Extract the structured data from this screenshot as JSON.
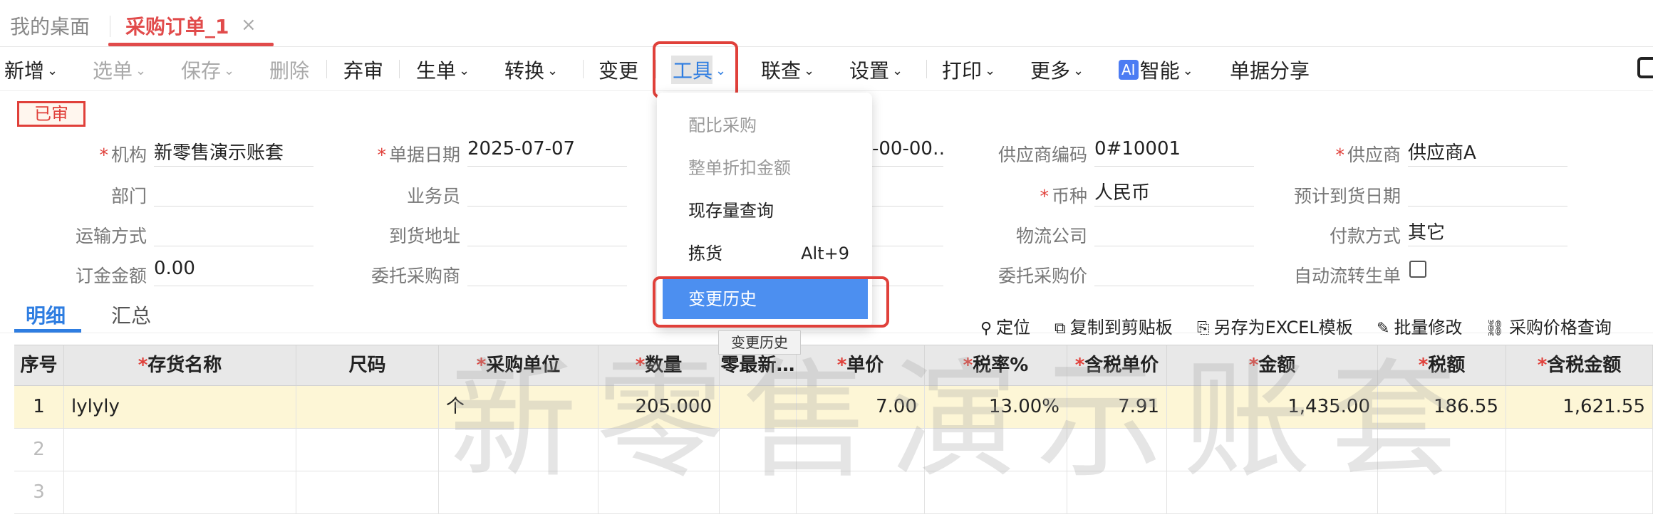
{
  "tabs": [
    {
      "label": "我的桌面"
    },
    {
      "label": "采购订单_1",
      "close": "×"
    }
  ],
  "toolbar": {
    "items": [
      {
        "label": "新增"
      },
      {
        "label": "选单"
      },
      {
        "label": "保存"
      },
      {
        "label": "删除"
      },
      {
        "label": "弃审"
      },
      {
        "label": "生单"
      },
      {
        "label": "转换"
      },
      {
        "label": "变更"
      },
      {
        "label": "工具"
      },
      {
        "label": "联查"
      },
      {
        "label": "设置"
      },
      {
        "label": "打印"
      },
      {
        "label": "更多"
      },
      {
        "label": "智能",
        "badge": "AI"
      },
      {
        "label": "单据分享"
      }
    ],
    "caret": "⌄"
  },
  "status_badge": "已审",
  "form": {
    "org_label": "机构",
    "org_value": "新零售演示账套",
    "date_label": "单据日期",
    "date_value": "2025-07-07",
    "partial_value": "-00-00…",
    "supplier_code_label": "供应商编码",
    "supplier_code_value": "0#10001",
    "supplier_label": "供应商",
    "supplier_value": "供应商A",
    "dept_label": "部门",
    "clerk_label": "业务员",
    "currency_label": "币种",
    "currency_value": "人民币",
    "expected_date_label": "预计到货日期",
    "shipping_label": "运输方式",
    "address_label": "到货地址",
    "logistics_label": "物流公司",
    "payment_label": "付款方式",
    "payment_value": "其它",
    "deposit_label": "订金金额",
    "deposit_value": "0.00",
    "agent_label": "委托采购商",
    "agent_price_label": "委托采购价",
    "auto_flow_label": "自动流转生单"
  },
  "subtabs": [
    {
      "label": "明细"
    },
    {
      "label": "汇总"
    }
  ],
  "table_tools": [
    {
      "icon": "⚲",
      "label": "定位"
    },
    {
      "icon": "⧉",
      "label": "复制到剪贴板"
    },
    {
      "icon": "⎘",
      "label": "另存为EXCEL模板"
    },
    {
      "icon": "✎",
      "label": "批量修改"
    },
    {
      "icon": "⛓",
      "label": "采购价格查询"
    }
  ],
  "table": {
    "columns": [
      "序号",
      "存货名称",
      "尺码",
      "采购单位",
      "数量",
      "零最新…",
      "单价",
      "税率%",
      "含税单价",
      "金额",
      "税额",
      "含税金额"
    ],
    "rows": [
      [
        "1",
        "lylyly",
        "",
        "个",
        "205.000",
        "",
        "7.00",
        "13.00%",
        "7.91",
        "1,435.00",
        "186.55",
        "1,621.55"
      ],
      [
        "2",
        "",
        "",
        "",
        "",
        "",
        "",
        "",
        "",
        "",
        "",
        ""
      ],
      [
        "3",
        "",
        "",
        "",
        "",
        "",
        "",
        "",
        "",
        "",
        "",
        ""
      ]
    ]
  },
  "watermark": "新零售演示账套",
  "dropdown": {
    "items": [
      {
        "label": "配比采购"
      },
      {
        "label": "整单折扣金额"
      },
      {
        "label": "现存量查询"
      },
      {
        "label": "拣货",
        "shortcut": "Alt+9"
      },
      {
        "label": "变更历史"
      }
    ],
    "tooltip": "变更历史"
  }
}
